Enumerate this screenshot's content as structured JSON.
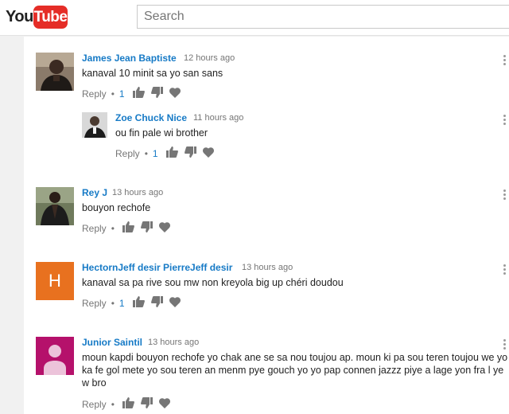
{
  "header": {
    "logo_you": "You",
    "logo_tube": "Tube",
    "search_placeholder": "Search"
  },
  "comments": [
    {
      "author": "James Jean Baptiste",
      "time": "12 hours ago",
      "text": "kanaval 10 minit sa yo san sans",
      "reply_label": "Reply",
      "likes": "1"
    },
    {
      "author": "Zoe Chuck Nice",
      "time": "11 hours ago",
      "text": "ou fin pale wi brother",
      "reply_label": "Reply",
      "likes": "1"
    },
    {
      "author": "Rey J",
      "time": "13 hours ago",
      "text": "bouyon rechofe",
      "reply_label": "Reply",
      "likes": ""
    },
    {
      "author": "HectornJeff desir PierreJeff desir",
      "time": "13 hours ago",
      "text": "kanaval sa pa rive sou mw non kreyola big up chéri doudou",
      "reply_label": "Reply",
      "likes": "1",
      "avatar_letter": "H"
    },
    {
      "author": "Junior Saintil",
      "time": "13 hours ago",
      "text": "moun kapdi bouyon rechofe yo chak ane se sa nou toujou ap. moun ki pa sou teren  toujou we yo ka fe gol mete yo sou teren an menm pye gouch yo yo pap connen jazzz piye a lage yon fra l ye w bro",
      "reply_label": "Reply",
      "likes": ""
    }
  ],
  "colors": {
    "author_link": "#167ac6",
    "brand_red": "#e52d27",
    "avatar_orange": "#e8711f",
    "avatar_magenta": "#b5116b"
  }
}
